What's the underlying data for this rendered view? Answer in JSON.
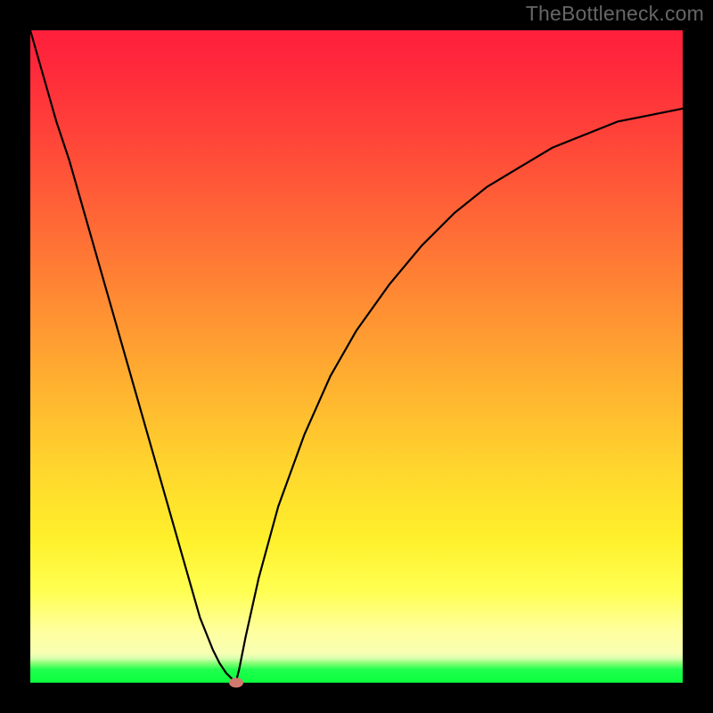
{
  "watermark": "TheBottleneck.com",
  "chart_data": {
    "type": "line",
    "title": "",
    "xlabel": "",
    "ylabel": "",
    "xlim": [
      0,
      1
    ],
    "ylim": [
      0,
      1
    ],
    "x": [
      0.0,
      0.02,
      0.04,
      0.06,
      0.08,
      0.1,
      0.12,
      0.14,
      0.16,
      0.18,
      0.2,
      0.22,
      0.24,
      0.26,
      0.28,
      0.29,
      0.3,
      0.31,
      0.315,
      0.32,
      0.33,
      0.35,
      0.38,
      0.42,
      0.46,
      0.5,
      0.55,
      0.6,
      0.65,
      0.7,
      0.75,
      0.8,
      0.85,
      0.9,
      0.95,
      1.0
    ],
    "values": [
      1.0,
      0.93,
      0.86,
      0.8,
      0.73,
      0.66,
      0.59,
      0.52,
      0.45,
      0.38,
      0.31,
      0.24,
      0.17,
      0.1,
      0.05,
      0.03,
      0.015,
      0.005,
      0.0,
      0.02,
      0.07,
      0.16,
      0.27,
      0.38,
      0.47,
      0.54,
      0.61,
      0.67,
      0.72,
      0.76,
      0.79,
      0.82,
      0.84,
      0.86,
      0.87,
      0.88
    ],
    "marker": {
      "x": 0.315,
      "y": 0.0
    },
    "gradient_stops": [
      {
        "pos": 0.0,
        "color": "#ff1f3b"
      },
      {
        "pos": 0.42,
        "color": "#ff8d33"
      },
      {
        "pos": 0.78,
        "color": "#fff02b"
      },
      {
        "pos": 0.96,
        "color": "#ffff9e"
      },
      {
        "pos": 1.0,
        "color": "#0bff3e"
      }
    ]
  }
}
